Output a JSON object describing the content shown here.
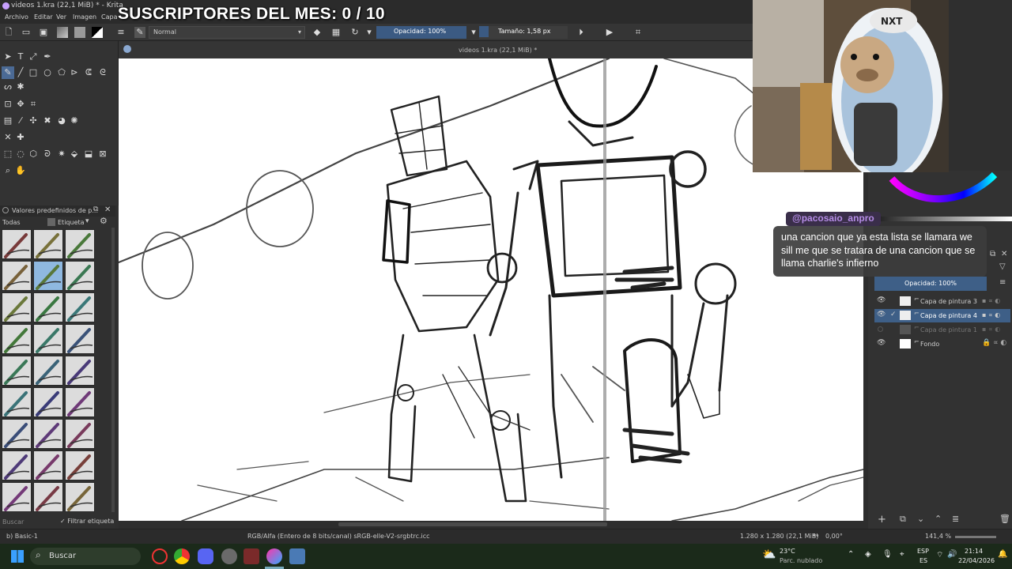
{
  "window": {
    "title": "videos 1.kra (22,1 MiB) * - Krita",
    "document_tab": "videos 1.kra (22,1 MiB) *"
  },
  "overlay": {
    "subscribers_text": "SUSCRIPTORES DEL MES: 0 / 10"
  },
  "menu": [
    "Archivo",
    "Editar",
    "Ver",
    "Imagen",
    "Capa"
  ],
  "toolbar": {
    "blend_mode": "Normal",
    "opacity_label": "Opacidad: 100%",
    "size_label": "Tamaño: 1,58 px",
    "opacity_fill": 1.0
  },
  "presets": {
    "title": "Valores predefinidos de p...",
    "filter_all": "Todas",
    "tag_label": "Etiqueta",
    "search_placeholder": "Buscar",
    "filter_tag": "Filtrar etiqueta"
  },
  "layers": {
    "opacity_label": "Opacidad:  100%",
    "items": [
      {
        "name": "Capa de pintura 3",
        "visible": true
      },
      {
        "name": "Capa de pintura 4",
        "visible": true,
        "selected": true
      },
      {
        "name": "Capa de pintura 1",
        "visible": false
      },
      {
        "name": "Fondo",
        "visible": true,
        "locked": true
      }
    ]
  },
  "statusbar": {
    "brush": "b) Basic-1",
    "colorspace": "RGB/Alfa (Entero de 8 bits/canal)  sRGB-elle-V2-srgbtrc.icc",
    "image_size": "1.280 x 1.280 (22,1 MiB)",
    "rotation": "0,00°",
    "zoom": "141,4 %"
  },
  "chat": {
    "username": "@pacosaio_anpro",
    "message": "una cancion que ya esta lista se llamara we sill me que se tratara de una cancion que se llama charlie's infierno"
  },
  "webcam": {
    "cap_text": "NXT"
  },
  "taskbar": {
    "search": "Buscar",
    "weather_temp": "23°C",
    "weather_desc": "Parc. nublado",
    "lang_top": "ESP",
    "lang_bottom": "ES",
    "time": "21:14",
    "date": "22/04/2026"
  },
  "colors": {
    "accent": "#3e5f87",
    "taskbar": "#1b2a1a",
    "chat_user": "#b58ce6"
  }
}
